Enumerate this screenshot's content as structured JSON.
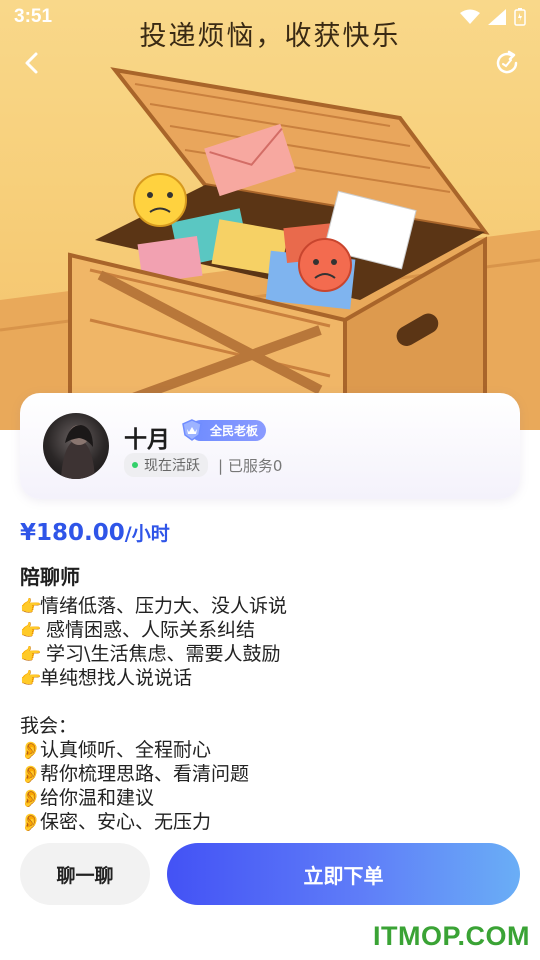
{
  "status_bar": {
    "time": "3:51"
  },
  "hero": {
    "title_partial": "",
    "title": "投递烦恼，收获快乐"
  },
  "profile": {
    "name": "十月",
    "badge": "全民老板",
    "status": "现在活跃",
    "served": "| 已服务0"
  },
  "price": {
    "amount": "¥180.00",
    "unit": "/小时"
  },
  "role": "陪聊师",
  "description": {
    "offers": [
      {
        "icon": "👉",
        "text": "情绪低落、压力大、没人诉说"
      },
      {
        "icon": "👉",
        "text": " 感情困惑、人际关系纠结"
      },
      {
        "icon": "👉",
        "text": " 学习\\生活焦虑、需要人鼓励"
      },
      {
        "icon": "👉",
        "text": "单纯想找人说说话"
      }
    ],
    "heading": "我会：",
    "promises": [
      {
        "icon": "👂",
        "text": "认真倾听、全程耐心"
      },
      {
        "icon": "👂",
        "text": "帮你梳理思路、看清问题"
      },
      {
        "icon": "👂",
        "text": "给你温和建议"
      },
      {
        "icon": "👂",
        "text": "保密、安心、无压力"
      }
    ]
  },
  "actions": {
    "chat": "聊一聊",
    "order": "立即下单"
  },
  "watermark": "ITMOP.COM",
  "colors": {
    "accent": "#2f55e8",
    "order_gradient_start": "#4352f5",
    "order_gradient_end": "#6aaef6",
    "active_dot": "#33d06a"
  }
}
